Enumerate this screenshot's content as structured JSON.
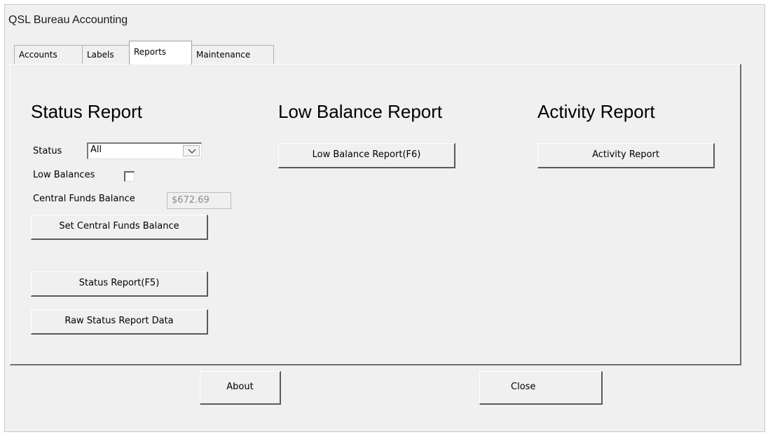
{
  "window": {
    "title": "QSL Bureau Accounting"
  },
  "tabs": [
    {
      "label": "Accounts",
      "active": false
    },
    {
      "label": "Labels",
      "active": false
    },
    {
      "label": "Reports",
      "active": true
    },
    {
      "label": "Maintenance",
      "active": false
    }
  ],
  "status_report": {
    "heading": "Status Report",
    "status_label": "Status",
    "status_value": "All",
    "low_balances_label": "Low Balances",
    "low_balances_checked": false,
    "central_funds_label": "Central Funds Balance",
    "central_funds_value": "$672.69",
    "set_central_button": "Set Central Funds Balance",
    "status_report_button": "Status Report(F5)",
    "raw_data_button": "Raw Status Report Data"
  },
  "low_balance_report": {
    "heading": "Low Balance Report",
    "button": "Low Balance Report(F6)"
  },
  "activity_report": {
    "heading": "Activity Report",
    "button": "Activity Report"
  },
  "footer": {
    "about_button": "About",
    "close_button": "Close"
  },
  "icons": {
    "dropdown": "chevron-down-icon"
  }
}
